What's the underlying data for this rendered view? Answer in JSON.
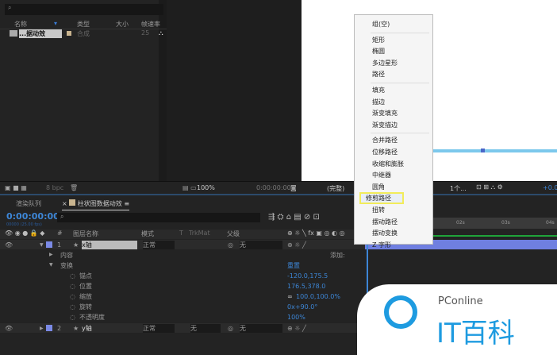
{
  "project": {
    "search_icon": "search-icon",
    "columns": [
      "名称",
      "类型",
      "大小",
      "帧速率"
    ],
    "item": {
      "name": "...据动效",
      "type": "合成",
      "fps": "25"
    },
    "bpc": "8 bpc"
  },
  "viewer": {
    "zoom": "100%",
    "timecode": "0:00:00:00",
    "quality": "(完整)",
    "views": "1个...",
    "offset": "+0.0"
  },
  "timeline": {
    "tabs": [
      "渲染队列",
      "柱状图数据动效"
    ],
    "timecode": "0:00:00:00",
    "frame_info": "00000 (25.00 fps)",
    "headers": [
      "#",
      "图层名称",
      "模式",
      "T",
      "TrkMat",
      "父级"
    ],
    "layers": [
      {
        "num": "1",
        "name": "x轴",
        "mode": "正常",
        "parent": "无"
      },
      {
        "num": "2",
        "name": "y轴",
        "mode": "正常",
        "trkmat": "无",
        "parent": "无"
      }
    ],
    "content": "内容",
    "add": "添加:",
    "transform": "变换",
    "reset": "重置",
    "props": [
      {
        "name": "锚点",
        "value": "-120.0,175.5"
      },
      {
        "name": "位置",
        "value": "176.5,378.0"
      },
      {
        "name": "缩放",
        "value": "100.0,100.0%"
      },
      {
        "name": "旋转",
        "value": "0x+90.0°"
      },
      {
        "name": "不透明度",
        "value": "100%"
      }
    ],
    "ruler": [
      "02s",
      "03s",
      "04s"
    ]
  },
  "menu": {
    "groups": [
      [
        "组(空)"
      ],
      [
        "矩形",
        "椭圆",
        "多边星形",
        "路径"
      ],
      [
        "填充",
        "描边",
        "渐变填充",
        "渐变描边"
      ],
      [
        "合并路径",
        "位移路径",
        "收缩和膨胀",
        "中继器",
        "圆角",
        "修剪路径",
        "扭转",
        "摆动路径",
        "摆动变换",
        "Z 字形"
      ]
    ],
    "highlighted": "修剪路径"
  },
  "watermark": {
    "brand": "PConline",
    "name": "IT百科"
  }
}
